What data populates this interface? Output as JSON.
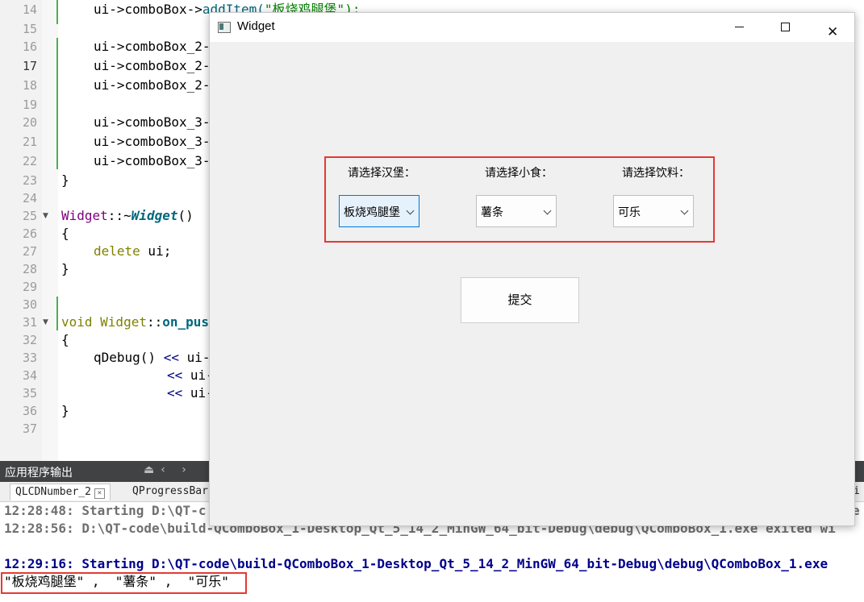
{
  "editor": {
    "line_numbers": [
      "14",
      "15",
      "16",
      "17",
      "18",
      "19",
      "20",
      "21",
      "22",
      "23",
      "24",
      "25",
      "26",
      "27",
      "28",
      "29",
      "30",
      "31",
      "32",
      "33",
      "34",
      "35",
      "36",
      "37"
    ],
    "lines": {
      "l14a": "ui->comboBox->",
      "l14b": "addItem(",
      "l14c": "\"板烧鸡腿堡\");",
      "l16": "ui->comboBox_2-",
      "l17": "ui->comboBox_2-",
      "l18": "ui->comboBox_2-",
      "l20": "ui->comboBox_3-",
      "l21": "ui->comboBox_3-",
      "l22": "ui->comboBox_3-",
      "l23": "}",
      "l25a": "Widget",
      "l25b": "::~",
      "l25c": "Widget",
      "l25d": "()",
      "l26": "{",
      "l27a": "delete",
      "l27b": " ui;",
      "l28": "}",
      "l31a": "void",
      "l31b": " Widget",
      "l31c": "::",
      "l31d": "on_pus",
      "l32": "{",
      "l33a": "qDebug",
      "l33b": "() ",
      "l33c": "<<",
      "l33d": " ui-",
      "l34a": "<<",
      "l34b": " ui-",
      "l35a": "<<",
      "l35b": " ui-",
      "l36": "}"
    }
  },
  "output": {
    "title": "应用程序输出",
    "tools": "⏏‹ ›",
    "tabs": [
      {
        "label": "QLCDNumber_2",
        "close": "×"
      },
      {
        "label": "QProgressBar"
      },
      {
        "label": "i"
      }
    ],
    "lines": {
      "line1": "12:28:48: Starting D:\\QT-c",
      "line2": "12:28:56: D:\\QT-code\\build-QComboBox_1-Desktop_Qt_5_14_2_MinGW_64_bit-Debug\\debug\\QComboBox_1.exe exited wi",
      "line3": "12:29:16: Starting D:\\QT-code\\build-QComboBox_1-Desktop_Qt_5_14_2_MinGW_64_bit-Debug\\debug\\QComboBox_1.exe",
      "line4": "\"板烧鸡腿堡\" ,  \"薯条\" ,  \"可乐\""
    },
    "line1_tail": "e"
  },
  "widget_window": {
    "title": "Widget",
    "minimize": "",
    "maximize": "",
    "close": "✕",
    "burger_label": "请选择汉堡：",
    "snack_label": "请选择小食：",
    "drink_label": "请选择饮料：",
    "burger_value": "板烧鸡腿堡",
    "snack_value": "薯条",
    "drink_value": "可乐",
    "submit_label": "提交"
  },
  "colors": {
    "highlight_box": "#e53935",
    "focus_border": "#0078d7",
    "change_bar": "#4caf50"
  }
}
